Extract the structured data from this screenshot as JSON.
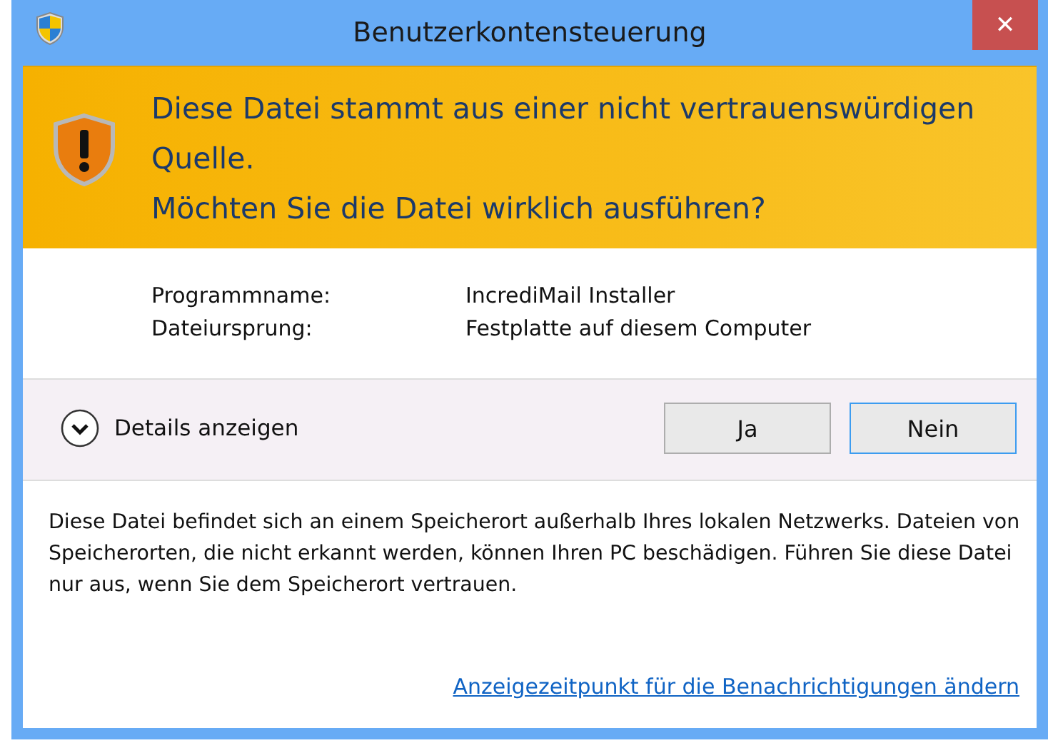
{
  "window": {
    "title": "Benutzerkontensteuerung",
    "close": "✕"
  },
  "header": {
    "lines": [
      "Diese Datei stammt aus einer nicht vertrauenswürdigen Quelle.",
      "Möchten Sie die Datei wirklich ausführen?"
    ]
  },
  "info": [
    {
      "label": "Programmname:",
      "value": "IncrediMail Installer"
    },
    {
      "label": "Dateiursprung:",
      "value": "Festplatte auf diesem Computer"
    }
  ],
  "details": {
    "label": "Details anzeigen",
    "expanded": false
  },
  "buttons": [
    {
      "label": "Ja",
      "default": false
    },
    {
      "label": "Nein",
      "default": true
    }
  ],
  "description": "Diese Datei befindet sich an einem Speicherort außerhalb Ihres lokalen Netzwerks. Dateien von Speicherorten, die nicht erkannt werden, können Ihren PC beschädigen. Führen Sie diese Datei nur aus, wenn Sie dem Speicherort vertrauen.",
  "link": "Anzeigezeitpunkt für die Benachrichtigungen ändern"
}
